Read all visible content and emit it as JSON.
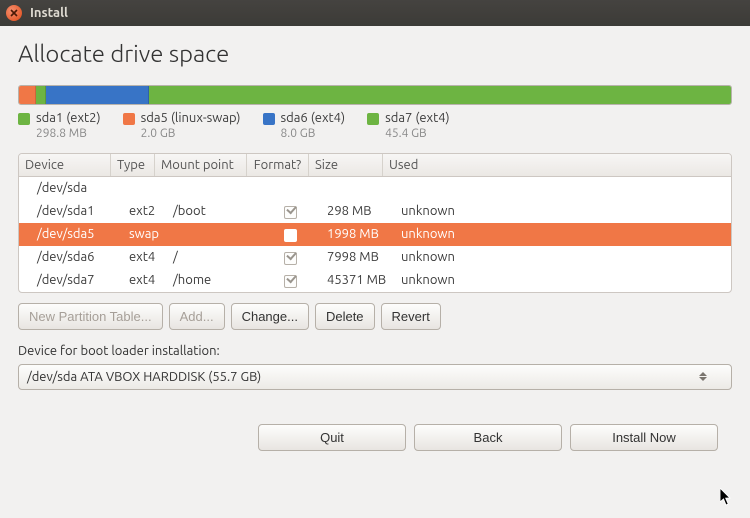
{
  "window": {
    "title": "Install"
  },
  "heading": "Allocate drive space",
  "colors": {
    "ext2": "#6db442",
    "swap": "#f07746",
    "sda6": "#3874c6",
    "sda7": "#6db442"
  },
  "bar": [
    {
      "colorKey": "swap",
      "width": 2.4
    },
    {
      "colorKey": "ext2",
      "width": 1.4
    },
    {
      "colorKey": "sda6",
      "width": 14.4
    },
    {
      "colorKey": "sda7",
      "width": 81.8
    }
  ],
  "legend": [
    {
      "label": "sda1 (ext2)",
      "size": "298.8 MB",
      "colorKey": "ext2"
    },
    {
      "label": "sda5 (linux-swap)",
      "size": "2.0 GB",
      "colorKey": "swap"
    },
    {
      "label": "sda6 (ext4)",
      "size": "8.0 GB",
      "colorKey": "sda6"
    },
    {
      "label": "sda7 (ext4)",
      "size": "45.4 GB",
      "colorKey": "sda7"
    }
  ],
  "columns": {
    "device": "Device",
    "type": "Type",
    "mount": "Mount point",
    "format": "Format?",
    "size": "Size",
    "used": "Used"
  },
  "rows": [
    {
      "device": "/dev/sda",
      "type": "",
      "mount": "",
      "format": null,
      "size": "",
      "used": "",
      "selected": false
    },
    {
      "device": " /dev/sda1",
      "type": "ext2",
      "mount": "/boot",
      "format": true,
      "size": "298 MB",
      "used": "unknown",
      "selected": false
    },
    {
      "device": " /dev/sda5",
      "type": "swap",
      "mount": "",
      "format": false,
      "size": "1998 MB",
      "used": "unknown",
      "selected": true
    },
    {
      "device": " /dev/sda6",
      "type": "ext4",
      "mount": "/",
      "format": true,
      "size": "7998 MB",
      "used": "unknown",
      "selected": false
    },
    {
      "device": " /dev/sda7",
      "type": "ext4",
      "mount": "/home",
      "format": true,
      "size": "45371 MB",
      "used": "unknown",
      "selected": false
    }
  ],
  "buttons": {
    "newTable": "New Partition Table...",
    "add": "Add...",
    "change": "Change...",
    "delete": "Delete",
    "revert": "Revert"
  },
  "bootLabel": "Device for boot loader installation:",
  "bootDevice": "/dev/sda ATA VBOX HARDDISK (55.7 GB)",
  "footer": {
    "quit": "Quit",
    "back": "Back",
    "install": "Install Now"
  }
}
